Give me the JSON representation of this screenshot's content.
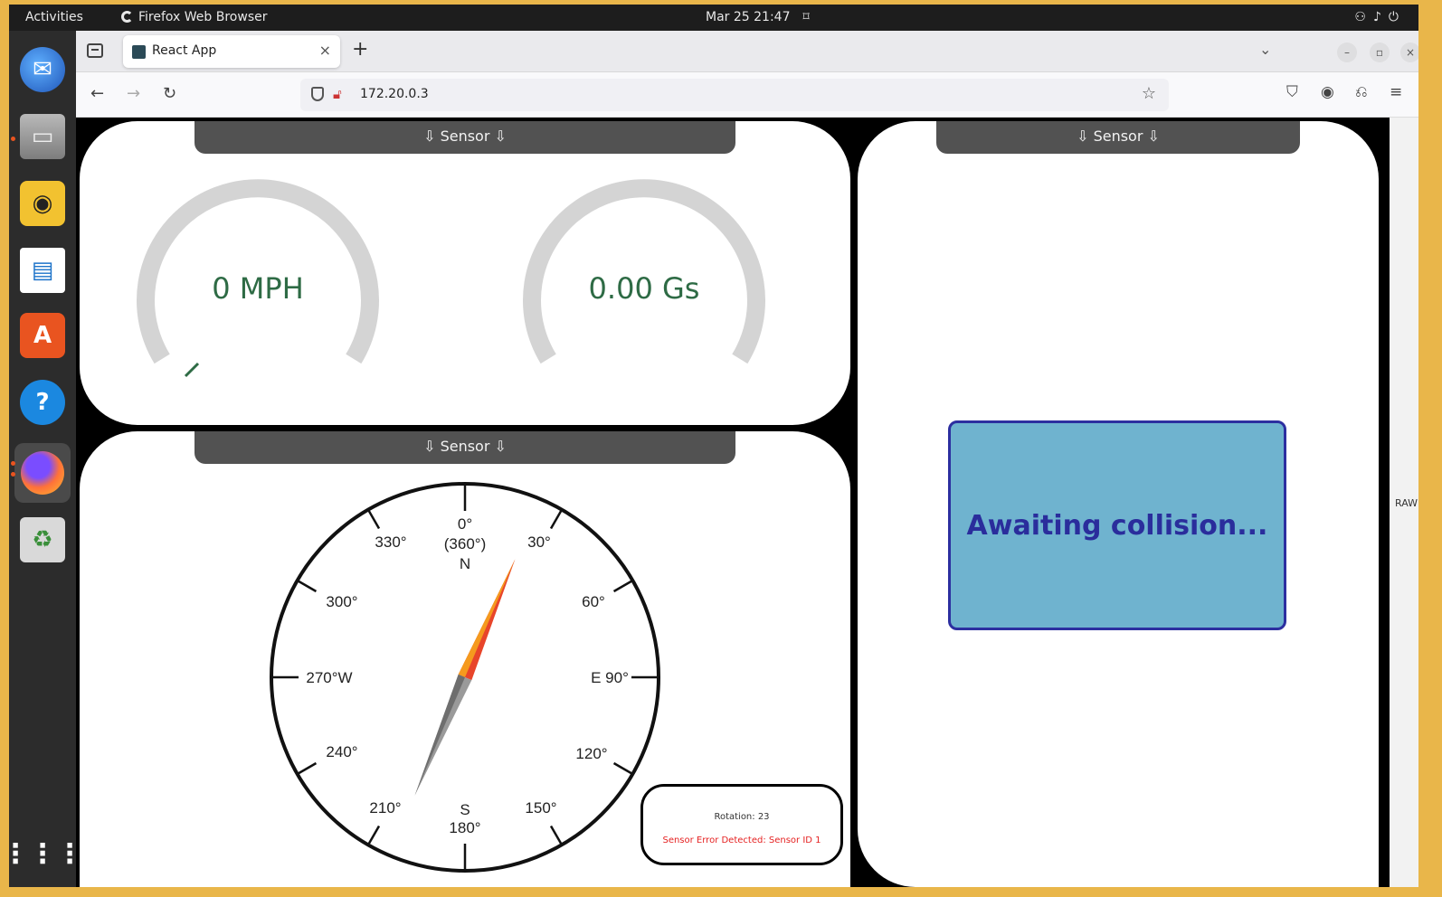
{
  "desktop": {
    "activities": "Activities",
    "app_name": "Firefox Web Browser",
    "clock": "Mar 25  21:47",
    "dock_items": [
      {
        "name": "thunderbird-icon",
        "color": "#1f6fd1"
      },
      {
        "name": "files-icon",
        "color": "#8a8a8a"
      },
      {
        "name": "rhythmbox-icon",
        "color": "#e7b321"
      },
      {
        "name": "libreoffice-writer-icon",
        "color": "#1d73c9"
      },
      {
        "name": "app-center-icon",
        "color": "#e95420"
      },
      {
        "name": "help-icon",
        "color": "#1b88e0"
      },
      {
        "name": "firefox-icon",
        "color": "#ff7139"
      },
      {
        "name": "trash-icon",
        "color": "#d9d9d9"
      },
      {
        "name": "show-apps-icon",
        "color": "#ffffff"
      }
    ]
  },
  "browser": {
    "tab_title": "React App",
    "url": "172.20.0.3"
  },
  "dashboard": {
    "sensor_label": "⇩ Sensor ⇩",
    "speed_text": "0 MPH",
    "gforce_text": "0.00 Gs",
    "collision_text": "Awaiting collision...",
    "raw_label": "RAW",
    "compass": {
      "north": "0°",
      "north_alt": "(360°)",
      "north_letter": "N",
      "south_letter": "S",
      "south": "180°",
      "labels": [
        "30°",
        "60°",
        "E 90°",
        "120°",
        "150°",
        "210°",
        "240°",
        "270°W",
        "300°",
        "330°"
      ],
      "needle_heading_deg": 23
    },
    "rotation_text": "Rotation: 23",
    "error_text": "Sensor Error Detected: Sensor ID 1",
    "colors": {
      "gauge_track": "#d4d4d4",
      "gauge_text": "#2e6b45",
      "collision_bg": "#6fb3cf",
      "collision_text": "#2a2d9c",
      "error_text": "#e52222"
    }
  }
}
